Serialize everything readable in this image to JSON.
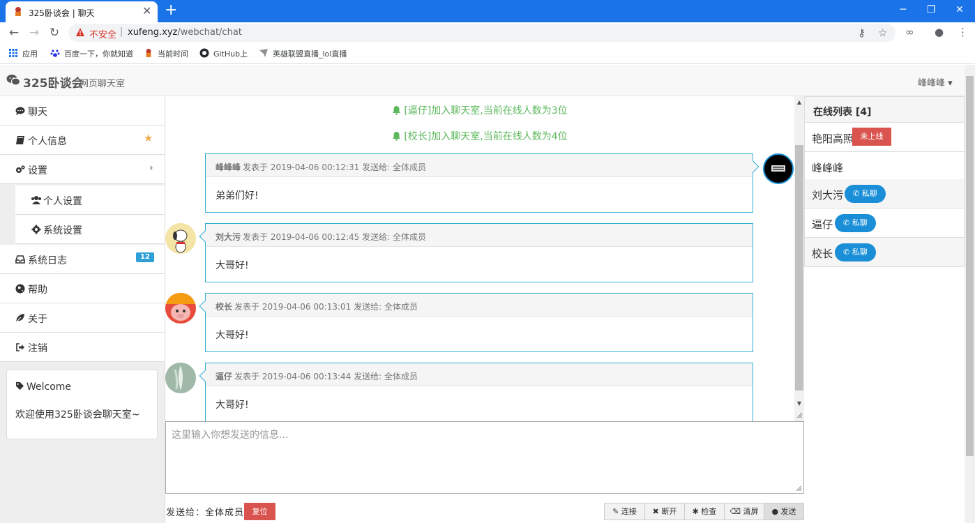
{
  "browser": {
    "tab_title": "325卧谈会 | 聊天",
    "new_tab": "+",
    "close_glyph": "✕",
    "insecure_label": "不安全",
    "url_host": "xufeng.xyz",
    "url_path": "/webchat/chat",
    "bookmarks": [
      "应用",
      "百度一下，你就知道",
      "当前时间",
      "GitHub上",
      "英雄联盟直播_lol直播"
    ],
    "accent_color": "#1a73e8"
  },
  "header": {
    "brand": "325卧谈会",
    "subtitle": "网页聊天室",
    "user": "峰峰峰 ▾"
  },
  "sidebar": {
    "items": [
      {
        "label": "聊天",
        "icon": "comment-icon"
      },
      {
        "label": "个人信息",
        "icon": "book-icon"
      },
      {
        "label": "设置",
        "icon": "cogs-icon"
      },
      {
        "label": "个人设置",
        "icon": "users-icon"
      },
      {
        "label": "系统设置",
        "icon": "gear-icon"
      },
      {
        "label": "系统日志",
        "icon": "inbox-icon"
      },
      {
        "label": "帮助",
        "icon": "globe-icon"
      },
      {
        "label": "关于",
        "icon": "leaf-icon"
      },
      {
        "label": "注销",
        "icon": "sign-out-icon"
      }
    ],
    "log_badge": "12",
    "welcome_title": "Welcome",
    "welcome_text": "欢迎使用325卧谈会聊天室~"
  },
  "chat": {
    "notices": [
      "[逼仔]加入聊天室,当前在线人数为3位",
      "[校长]加入聊天室,当前在线人数为4位"
    ],
    "messages": [
      {
        "author": "峰峰峰",
        "meta": "发表于 2019-04-06 00:12:31 发送给: 全体成员",
        "text": "弟弟们好!",
        "side": "right"
      },
      {
        "author": "刘大污",
        "meta": "发表于 2019-04-06 00:12:45 发送给: 全体成员",
        "text": "大哥好!",
        "side": "left"
      },
      {
        "author": "校长",
        "meta": "发表于 2019-04-06 00:13:01 发送给: 全体成员",
        "text": "大哥好!",
        "side": "left"
      },
      {
        "author": "逼仔",
        "meta": "发表于 2019-04-06 00:13:44 发送给: 全体成员",
        "text": "大哥好!",
        "side": "left"
      }
    ],
    "composer_placeholder": "这里输入你想发送的信息...",
    "send_to": "发送给：全体成员",
    "reset": "复位",
    "actions": [
      "连接",
      "断开",
      "检查",
      "清屏",
      "发送"
    ]
  },
  "online": {
    "title": "在线列表 [4]",
    "users": [
      {
        "name": "艳阳高照",
        "status": "未上线"
      },
      {
        "name": "峰峰峰",
        "status": ""
      },
      {
        "name": "刘大污",
        "status": "私聊"
      },
      {
        "name": "逼仔",
        "status": "私聊"
      },
      {
        "name": "校长",
        "status": "私聊"
      }
    ]
  }
}
